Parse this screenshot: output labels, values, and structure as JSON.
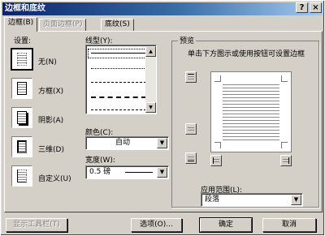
{
  "window": {
    "title": "边框和底纹",
    "help": "?",
    "close": "×"
  },
  "tabs": [
    {
      "label": "边框(B)",
      "state": "active"
    },
    {
      "label": "页面边框(P)",
      "state": "disabled"
    },
    {
      "label": "底纹(S)",
      "state": "normal"
    }
  ],
  "settings": {
    "heading": "设置:",
    "items": [
      {
        "label": "无(N)",
        "selected": true
      },
      {
        "label": "方框(X)"
      },
      {
        "label": "阴影(A)"
      },
      {
        "label": "三维(D)"
      },
      {
        "label": "自定义(U)"
      }
    ]
  },
  "line_style": {
    "heading": "线型(Y):"
  },
  "color": {
    "label": "颜色(C):",
    "value": "自动"
  },
  "width": {
    "label": "宽度(W):",
    "value": "0.5 磅"
  },
  "preview": {
    "heading": "预览",
    "hint": "单击下方图示或使用按钮可设置边框"
  },
  "apply_to": {
    "label": "应用范围(L):",
    "value": "段落"
  },
  "footer": {
    "toolbar_button": "显示工具栏(T)",
    "options_button": "选项(O)...",
    "ok_button": "确定",
    "cancel_button": "取消"
  },
  "colors": {
    "titlebar_start": "#0a246a",
    "titlebar_end": "#a6caf0",
    "face": "#d4d0c8"
  }
}
